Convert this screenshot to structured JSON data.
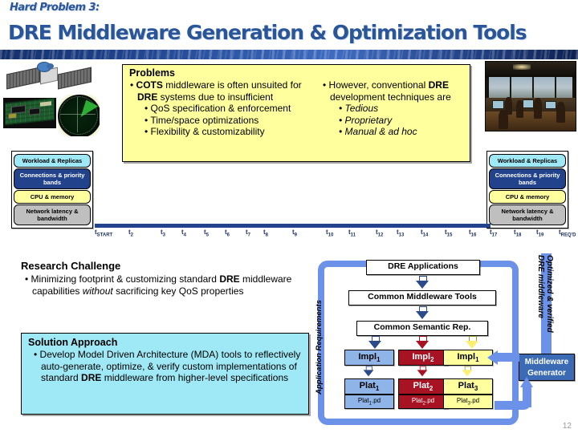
{
  "header": {
    "eyebrow": "Hard Problem 3:",
    "title": "DRE Middleware Generation & Optimization Tools"
  },
  "problems": {
    "heading": "Problems",
    "left_bullets": [
      "COTS middleware is often unsuited for DRE systems due to insufficient",
      "QoS specification & enforcement",
      "Time/space optimizations",
      "Flexibility & customizability"
    ],
    "right_bullets": [
      "However, conventional DRE development techniques are",
      "Tedious",
      "Proprietary",
      "Manual & ad hoc"
    ]
  },
  "resource_stack": {
    "cells": [
      {
        "label": "Workload & Replicas",
        "color": "#9fe8f5"
      },
      {
        "label": "Connections & priority bands",
        "color": "#22438c"
      },
      {
        "label": "CPU & memory",
        "color": "#ffff9e"
      },
      {
        "label": "Network latency & bandwidth",
        "color": "#bfbfbf"
      }
    ]
  },
  "timeline": {
    "ticks": [
      "START",
      "2",
      "3",
      "4",
      "5",
      "6",
      "7",
      "8",
      "9",
      "10",
      "11",
      "12",
      "13",
      "14",
      "15",
      "16",
      "17",
      "18",
      "19",
      "REQ'D"
    ],
    "prefix": "t"
  },
  "research_challenge": {
    "heading": "Research Challenge",
    "body_1": "Minimizing footprint & customizing standard ",
    "body_bold": "DRE",
    "body_2": " middleware capabilities ",
    "body_italic": "without",
    "body_3": " sacrificing key QoS properties"
  },
  "solution_approach": {
    "heading": "Solution Approach",
    "body_1": "Develop Model Driven Architecture (MDA) tools to reflectively auto-generate, optimize, & verify custom implementations of standard ",
    "body_bold": "DRE",
    "body_2": " middleware from higher-level specifications"
  },
  "diagram": {
    "app_requirements_label": "Application Requirements",
    "boxes": [
      "DRE Applications",
      "Common Middleware Tools",
      "Common Semantic Rep."
    ],
    "impls": [
      {
        "name": "Impl",
        "sub": "1",
        "color": "#8fb4e8"
      },
      {
        "name": "Impl",
        "sub": "2",
        "color": "#a81324"
      },
      {
        "name": "Impl",
        "sub": "1",
        "color": "#ffff9e"
      }
    ],
    "plats": [
      {
        "name": "Plat",
        "sub": "1",
        "color": "#8fb4e8"
      },
      {
        "name": "Plat",
        "sub": "2",
        "color": "#a81324"
      },
      {
        "name": "Plat",
        "sub": "3",
        "color": "#ffff9e"
      }
    ],
    "pds": [
      {
        "name": "Plat",
        "sub": "1",
        "ext": ".pd",
        "color": "#8fb4e8"
      },
      {
        "name": "Plat",
        "sub": "2",
        "ext": ".pd",
        "color": "#a81324"
      },
      {
        "name": "Plat",
        "sub": "3",
        "ext": ".pd",
        "color": "#ffff9e"
      }
    ],
    "generator_line1": "Middleware",
    "generator_line2": "Generator",
    "optimized_label_1": "Optimized & verified",
    "optimized_label_2": "DRE middleware"
  },
  "page_number": "12",
  "colors": {
    "title_blue": "#2a5699",
    "band_navy": "#1d3f86",
    "accent_blue": "#6b92e8",
    "cyan": "#9fe8f5",
    "yellow": "#ffff9e",
    "red": "#a81324"
  }
}
